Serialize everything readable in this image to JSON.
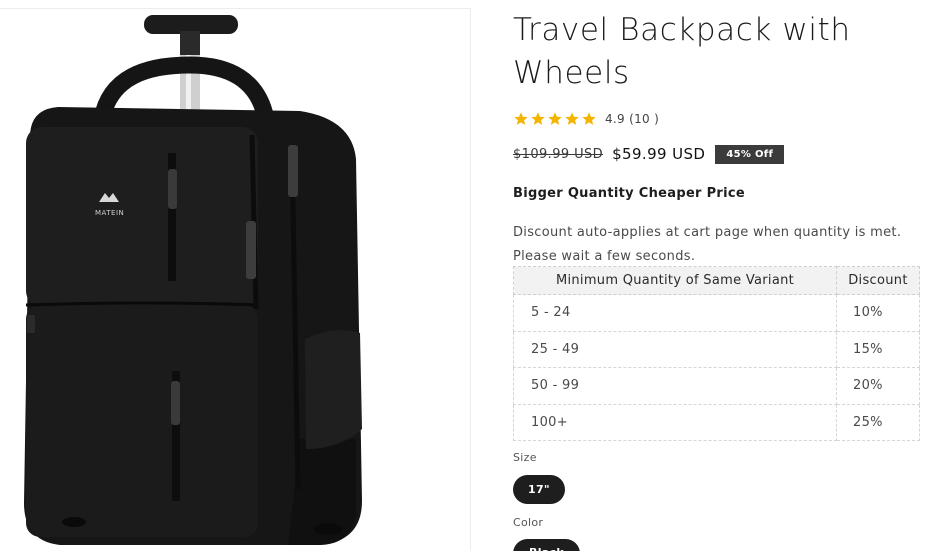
{
  "product": {
    "title": "Travel Backpack with Wheels",
    "image_alt": "Black rolling travel backpack",
    "brand_logo_text": "MATEIN",
    "rating": {
      "stars": 5,
      "text": "4.9 (10 )"
    },
    "price": {
      "compare_at": "$109.99 USD",
      "sale": "$59.99 USD",
      "badge": "45% Off"
    }
  },
  "promo": {
    "heading": "Bigger Quantity Cheaper Price",
    "text": "Discount auto-applies at cart page when quantity is met. Please wait a few seconds."
  },
  "discount_table": {
    "headers": [
      "Minimum Quantity of Same Variant",
      "Discount"
    ],
    "rows": [
      [
        "5 - 24",
        "10%"
      ],
      [
        "25 - 49",
        "15%"
      ],
      [
        "50 - 99",
        "20%"
      ],
      [
        "100+",
        "25%"
      ]
    ]
  },
  "options": {
    "size": {
      "label": "Size",
      "selected": "17\""
    },
    "color": {
      "label": "Color",
      "selected": "Black"
    }
  },
  "colors": {
    "star": "#f4b400",
    "badge_bg": "#3b3b3b",
    "pill_bg": "#1e1e1e"
  }
}
